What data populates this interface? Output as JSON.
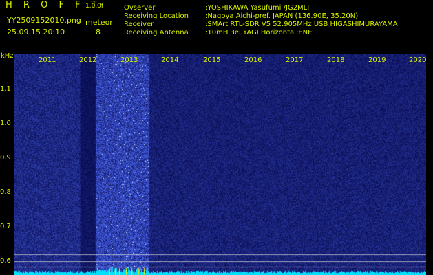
{
  "header": {
    "app_name": "H R O F F T",
    "version": "1.0.0f",
    "filename": "YY2509152010.png",
    "meteor_label": "meteor",
    "meteor_count": "8",
    "timestamp": "25.09.15 20:10"
  },
  "info": [
    {
      "label": "Ovserver",
      "value": ":YOSHIKAWA Yasufumi /JG2MLI"
    },
    {
      "label": "Receiving Location",
      "value": ":Nagoya Aichi-pref. JAPAN (136.90E, 35.20N)"
    },
    {
      "label": "Receiver",
      "value": ":SMArt RTL-SDR V5 52.905MHz USB HIGASHIMURAYAMA"
    },
    {
      "label": "Receiving Antenna",
      "value": ":10mH 3el.YAGI Horizontal:ENE"
    }
  ],
  "axis": {
    "unit": "kHz",
    "y_ticks": [
      "1.1",
      "1.0",
      "0.9",
      "0.8",
      "0.7",
      "0.6"
    ],
    "x_ticks": [
      "2011",
      "2012",
      "2013",
      "2014",
      "2015",
      "2016",
      "2017",
      "2018",
      "2019",
      "2020"
    ]
  },
  "colors": {
    "text": "#d8f000",
    "background": "#000000",
    "noise_dark": "#0a0a6a",
    "noise_bright": "#4060ff",
    "baseline": "#00e0ff"
  }
}
